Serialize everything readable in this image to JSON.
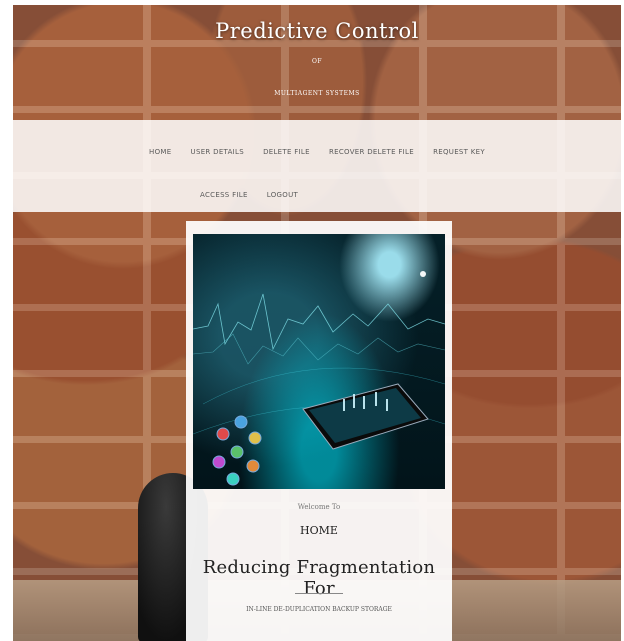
{
  "site": {
    "title": "Predictive Control",
    "of": "OF",
    "subtitle": "MULTIAGENT SYSTEMS"
  },
  "nav": {
    "row1": [
      "HOME",
      "USER DETAILS",
      "DELETE FILE",
      "RECOVER DELETE FILE",
      "REQUEST KEY"
    ],
    "row2": [
      "ACCESS FILE",
      "LOGOUT"
    ]
  },
  "card": {
    "welcome": "Welcome To",
    "heading": "HOME",
    "title": "Reducing Fragmentation For",
    "subtitle": "IN-LINE DE-DUPLICATION BACKUP STORAGE"
  },
  "colors": {
    "nav_bg": "#ffffff",
    "nav_text": "#5a5a5a",
    "card_bg": "#ffffff",
    "brick": "#8a5038"
  }
}
